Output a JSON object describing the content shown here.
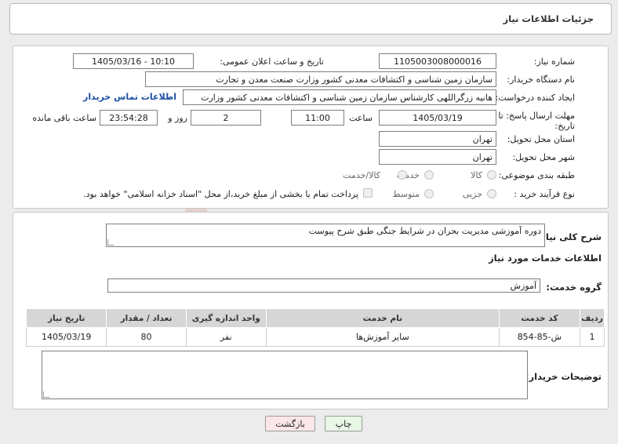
{
  "header": {
    "title": "جزئیات اطلاعات نیاز"
  },
  "info": {
    "need_number_label": "شماره نیاز:",
    "need_number": "1105003008000016",
    "announce_label": "تاریخ و ساعت اعلان عمومی:",
    "announce_value": "1405/03/16 - 10:10",
    "buyer_org_label": "نام دستگاه خریدار:",
    "buyer_org": "سازمان زمین شناسی و اکتشافات معدنی کشور وزارت صنعت معدن و تجارت",
    "creator_label": "ایجاد کننده درخواست:",
    "creator": "هانیه زرگراللهی کارشناس سازمان زمین شناسی و اکتشافات معدنی کشور وزارت",
    "contact_link": "اطلاعات تماس خریدار",
    "deadline_label_1": "مهلت ارسال پاسخ: تا",
    "deadline_label_2": "تاریخ:",
    "deadline_date": "1405/03/19",
    "time_label": "ساعت",
    "deadline_time": "11:00",
    "days_value": "2",
    "days_label": "روز و",
    "remaining_time": "23:54:28",
    "remaining_label": "ساعت باقی مانده",
    "province_label": "استان محل تحویل:",
    "province": "تهران",
    "city_label": "شهر محل تحویل:",
    "city": "تهران",
    "category_label": "طبقه بندی موضوعی:",
    "category_options": [
      "کالا",
      "خدمت",
      "کالا/خدمت"
    ],
    "process_label": "نوع فرآیند خرید :",
    "process_options": [
      "جزیی",
      "متوسط"
    ],
    "payment_note": "پرداخت تمام یا بخشی از مبلغ خرید،از محل \"اسناد خزانه اسلامی\" خواهد بود."
  },
  "details": {
    "summary_label": "شرح کلی نیاز:",
    "summary": "دوره آموزشی مدیریت بحران در شرایط جنگی طبق شرح پیوست",
    "services_heading": "اطلاعات خدمات مورد نیاز",
    "service_group_label": "گروه خدمت:",
    "service_group": "آموزش",
    "table": {
      "headers": [
        "ردیف",
        "کد خدمت",
        "نام خدمت",
        "واحد اندازه گیری",
        "تعداد / مقدار",
        "تاریخ نیاز"
      ],
      "rows": [
        [
          "1",
          "ش-85-854",
          "سایر آموزش‌ها",
          "نفر",
          "80",
          "1405/03/19"
        ]
      ]
    },
    "buyer_notes_label": "توضیحات خریدار:",
    "buyer_notes": ""
  },
  "buttons": {
    "print": "چاپ",
    "back": "بازگشت"
  },
  "colors": {
    "print_bg": "#e9f7e6",
    "back_bg": "#fbe7e7",
    "watermark": "#c0392b"
  }
}
